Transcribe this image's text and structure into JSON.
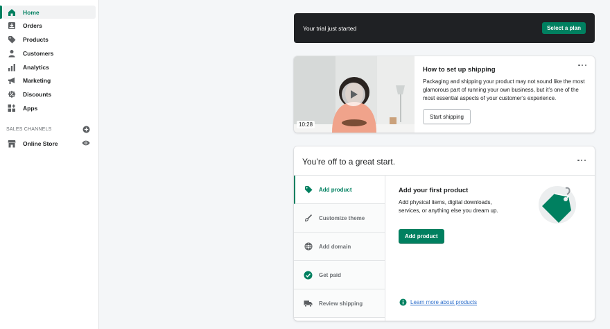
{
  "sidebar": {
    "items": [
      {
        "label": "Home",
        "icon": "home-icon",
        "active": true
      },
      {
        "label": "Orders",
        "icon": "orders-icon"
      },
      {
        "label": "Products",
        "icon": "tag-icon"
      },
      {
        "label": "Customers",
        "icon": "person-icon"
      },
      {
        "label": "Analytics",
        "icon": "bar-chart-icon"
      },
      {
        "label": "Marketing",
        "icon": "megaphone-icon"
      },
      {
        "label": "Discounts",
        "icon": "discount-icon"
      },
      {
        "label": "Apps",
        "icon": "apps-icon"
      }
    ],
    "sales_channels_title": "SALES CHANNELS",
    "online_store": "Online Store"
  },
  "trial": {
    "text": "Your trial just started",
    "button": "Select a plan"
  },
  "video_card": {
    "duration": "10:28",
    "title": "How to set up shipping",
    "description": "Packaging and shipping your product may not sound like the most glamorous part of running your own business, but it’s one of the most essential aspects of your customer’s experience.",
    "button": "Start shipping"
  },
  "setup": {
    "title": "You’re off to a great start.",
    "tabs": [
      {
        "label": "Add product",
        "icon": "tag-icon",
        "active": true
      },
      {
        "label": "Customize theme",
        "icon": "brush-icon"
      },
      {
        "label": "Add domain",
        "icon": "globe-icon"
      },
      {
        "label": "Get paid",
        "icon": "check-circle-icon"
      },
      {
        "label": "Review shipping",
        "icon": "truck-icon"
      }
    ],
    "panel_title": "Add your first product",
    "panel_desc": "Add physical items, digital downloads, services, or anything else you dream up.",
    "panel_button": "Add product",
    "learn_more": "Learn more about products"
  },
  "colors": {
    "accent": "#008060",
    "trial_bg": "#1f2124",
    "link": "#2c6ecb"
  }
}
